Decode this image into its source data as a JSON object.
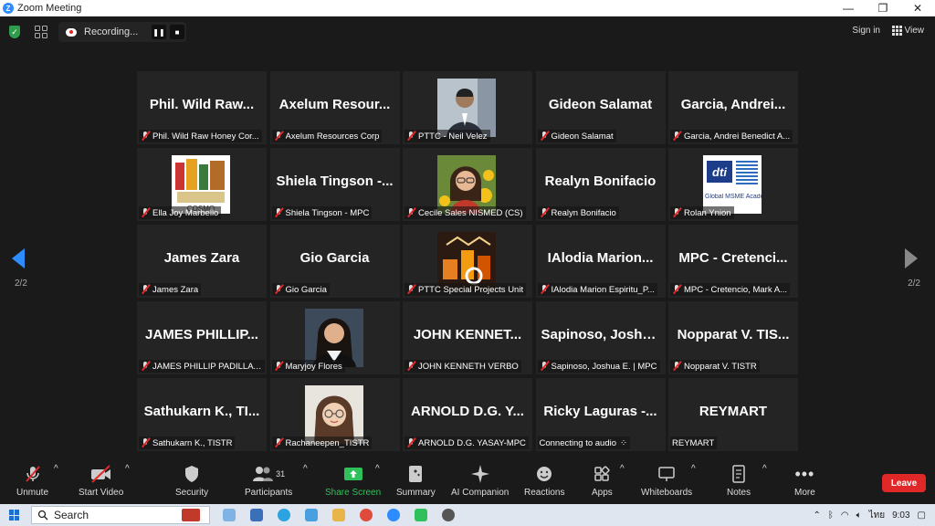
{
  "window": {
    "title": "Zoom Meeting",
    "min": "—",
    "restore": "❐",
    "close": "✕"
  },
  "topbar": {
    "recording_label": "Recording...",
    "pause": "❚❚",
    "stop": "■",
    "signin": "Sign in",
    "view": "View"
  },
  "pagination": {
    "left": "2/2",
    "right": "2/2"
  },
  "tiles": [
    {
      "big": "Phil. Wild Raw...",
      "label": "Phil. Wild Raw Honey Cor..."
    },
    {
      "big": "Axelum  Resour...",
      "label": "Axelum Resources Corp"
    },
    {
      "big": "",
      "label": "PTTC - Neil Velez",
      "photo": "man-suit"
    },
    {
      "big": "Gideon Salamat",
      "label": "Gideon Salamat"
    },
    {
      "big": "Garcia,  Andrei...",
      "label": "Garcia, Andrei Benedict A..."
    },
    {
      "big": "",
      "label": "Ella Joy Marbello",
      "photo": "products"
    },
    {
      "big": "Shiela Tingson -...",
      "label": "Shiela Tingson - MPC"
    },
    {
      "big": "",
      "label": "Cecile Sales NISMED (CS)",
      "photo": "woman-flowers"
    },
    {
      "big": "Realyn Bonifacio",
      "label": "Realyn Bonifacio"
    },
    {
      "big": "",
      "label": "Rolan Ynion",
      "photo": "dti-logo",
      "photo_text": "dti",
      "photo_caption": "Global MSME Acade"
    },
    {
      "big": "James Zara",
      "label": "James Zara"
    },
    {
      "big": "Gio Garcia",
      "label": "Gio Garcia"
    },
    {
      "big": "",
      "label": "PTTC Special Projects Unit",
      "photo": "industry-art"
    },
    {
      "big": "IAlodia  Marion...",
      "label": "IAlodia Marion Espiritu_P..."
    },
    {
      "big": "MPC - Cretenci...",
      "label": "MPC - Cretencio, Mark A..."
    },
    {
      "big": "JAMES  PHILLIP...",
      "label": "JAMES PHILLIP PADILLA ..."
    },
    {
      "big": "",
      "label": "Maryjoy Flores",
      "photo": "grad-woman"
    },
    {
      "big": "JOHN  KENNET...",
      "label": "JOHN KENNETH VERBO"
    },
    {
      "big": "Sapinoso,  Joshu...",
      "label": "Sapinoso, Joshua E. | MPC"
    },
    {
      "big": "Nopparat V. TIS...",
      "label": "Nopparat V. TISTR"
    },
    {
      "big": "Sathukarn K., TI...",
      "label": "Sathukarn K., TISTR"
    },
    {
      "big": "",
      "label": "Rachaneepen_TISTR",
      "photo": "woman-glasses"
    },
    {
      "big": "ARNOLD D.G. Y...",
      "label": "ARNOLD D.G. YASAY-MPC"
    },
    {
      "big": "Ricky Laguras -...",
      "label": "Connecting to audio",
      "nomute": true
    },
    {
      "big": "REYMART",
      "label": "REYMART",
      "nomute": true
    }
  ],
  "toolbar": {
    "unmute": "Unmute",
    "start_video": "Start Video",
    "security": "Security",
    "participants": "Participants",
    "participants_count": "31",
    "share_screen": "Share Screen",
    "summary": "Summary",
    "ai_companion": "AI Companion",
    "reactions": "Reactions",
    "apps": "Apps",
    "whiteboards": "Whiteboards",
    "notes": "Notes",
    "more": "More",
    "leave": "Leave"
  },
  "taskbar": {
    "search": "Search",
    "lang": "ไทย",
    "time": "9:03"
  },
  "colors": {
    "accent": "#2d8cff",
    "share_green": "#2fc05b",
    "leave_red": "#e02828",
    "tile_bg": "#242424"
  }
}
